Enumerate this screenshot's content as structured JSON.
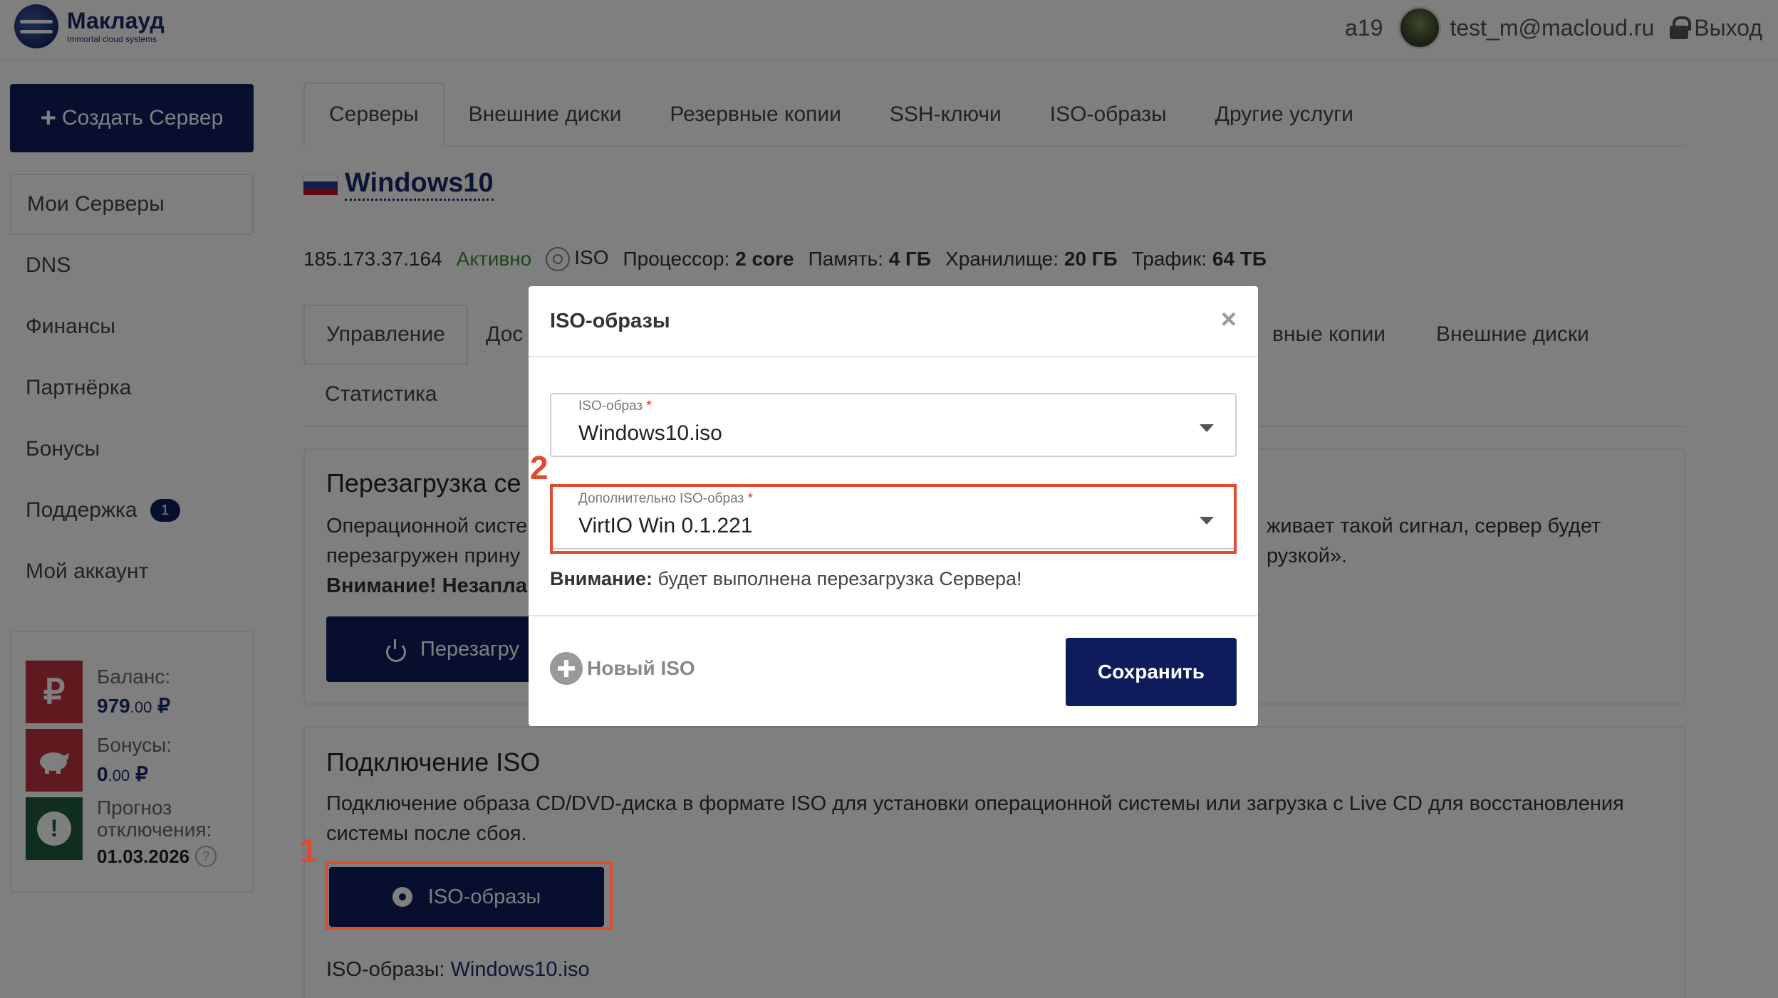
{
  "header": {
    "logo_name": "Маклауд",
    "logo_tagline": "Immortal cloud systems",
    "account_id": "a19",
    "user_email": "test_m@macloud.ru",
    "logout_label": "Выход"
  },
  "sidebar": {
    "create_button": "Создать Сервер",
    "items": [
      {
        "label": "Мои Серверы"
      },
      {
        "label": "DNS"
      },
      {
        "label": "Финансы"
      },
      {
        "label": "Партнёрка"
      },
      {
        "label": "Бонусы"
      },
      {
        "label": "Поддержка",
        "badge": "1"
      },
      {
        "label": "Мой аккаунт"
      }
    ],
    "balance": {
      "balance_label": "Баланс:",
      "balance_int": "979",
      "balance_frac": ".00",
      "currency": "₽",
      "bonus_label": "Бонусы:",
      "bonus_int": "0",
      "bonus_frac": ".00",
      "forecast_label_1": "Прогноз",
      "forecast_label_2": "отключения:",
      "forecast_date": "01.03.2026",
      "help_glyph": "?",
      "rub_glyph": "₽",
      "alert_glyph": "!"
    }
  },
  "main": {
    "tabs": [
      {
        "label": "Серверы"
      },
      {
        "label": "Внешние диски"
      },
      {
        "label": "Резервные копии"
      },
      {
        "label": "SSH-ключи"
      },
      {
        "label": "ISO-образы"
      },
      {
        "label": "Другие услуги"
      }
    ],
    "server": {
      "name": "Windows10",
      "ip": "185.173.37.164",
      "status": "Активно",
      "iso": "ISO",
      "cpu_label": "Процессор:",
      "cpu_value": "2 core",
      "ram_label": "Память:",
      "ram_value": "4 ГБ",
      "storage_label": "Хранилище:",
      "storage_value": "20 ГБ",
      "traffic_label": "Трафик:",
      "traffic_value": "64 ТБ"
    },
    "subtabs": {
      "manage": "Управление",
      "access_partial": "Дос",
      "backups_partial": "вные копии",
      "ext_disks": "Внешние диски",
      "stats": "Статистика"
    },
    "reboot_card": {
      "title_partial": "Перезагрузка се",
      "text_left_1": "Операционной систе",
      "text_left_2": "перезагружен прину",
      "text_left_3": "Внимание! Незаплан",
      "text_right_1": "живает такой сигнал, сервер будет",
      "text_right_2": "рузкой».",
      "button_partial": "Перезагру"
    },
    "iso_card": {
      "title": "Подключение ISO",
      "text": "Подключение образа CD/DVD-диска в формате ISO для установки операционной системы или загрузка с Live CD для восстановления системы после сбоя.",
      "button": "ISO-образы",
      "current_label": "ISO-образы:",
      "current_value": "Windows10.iso"
    },
    "step_1": "1",
    "step_2": "2"
  },
  "modal": {
    "title": "ISO-образы",
    "close": "×",
    "iso_field_label": "ISO-образ",
    "iso_field_value": "Windows10.iso",
    "extra_field_label": "Дополнительно ISO-образ",
    "extra_field_value": "VirtIO Win 0.1.221",
    "required_mark": "*",
    "warning_bold": "Внимание:",
    "warning_text": "будет выполнена перезагрузка Сервера!",
    "new_iso": "Новый ISO",
    "save": "Сохранить"
  },
  "colors": {
    "brand": "#0f1c5c",
    "accent_red": "#e04a2e",
    "status_green": "#3a8a3a"
  }
}
